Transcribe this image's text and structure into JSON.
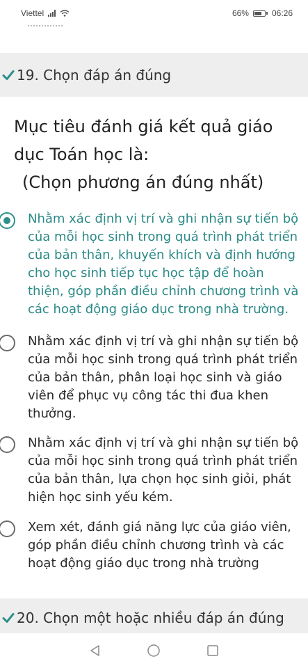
{
  "status_bar": {
    "carrier": "Viettel",
    "battery": "66%",
    "time": "06:26"
  },
  "questions": [
    {
      "title": "19. Chọn đáp án đúng",
      "prompt_line1": "Mục tiêu đánh giá  kết quả giáo dục Toán học là:",
      "prompt_line2": "(Chọn phương án đúng nhất)",
      "options": [
        {
          "selected": true,
          "lines": [
            "Nhằm xác định vị trí và ghi nhận sự tiến bộ",
            "của mỗi học sinh trong quá trình phát triển",
            "của bản thân, khuyến khích và định hướng",
            "cho học sinh tiếp tục học tập để hoàn",
            "thiện, góp phần điều chỉnh chương trình và",
            "các hoạt động giáo dục trong nhà trường."
          ]
        },
        {
          "selected": false,
          "lines": [
            "Nhằm xác định vị trí và ghi nhận sự tiến bộ",
            "của mỗi học sinh trong quá trình phát triển",
            "của bản thân, phân loại học sinh và giáo",
            "viên để phục vụ công tác thi đua khen",
            "thưởng."
          ]
        },
        {
          "selected": false,
          "lines": [
            "Nhằm xác định vị trí và ghi nhận sự tiến bộ",
            "của mỗi học sinh trong quá trình phát triển",
            "của bản thân, lựa chọn học sinh giỏi, phát",
            "hiện học sinh yếu kém."
          ]
        },
        {
          "selected": false,
          "lines": [
            "Xem xét, đánh giá năng lực của giáo viên,",
            "góp phần điều chỉnh chương trình và các",
            "hoạt động giáo dục trong nhà trường"
          ]
        }
      ]
    },
    {
      "title": "20. Chọn một hoặc nhiều đáp án đúng"
    }
  ],
  "nav_bar": {
    "icons": [
      "back-icon",
      "home-icon",
      "recents-icon"
    ]
  },
  "colors": {
    "accent": "#2a8a86",
    "header_bg": "#eeeeee",
    "check": "#2f8f8a"
  }
}
